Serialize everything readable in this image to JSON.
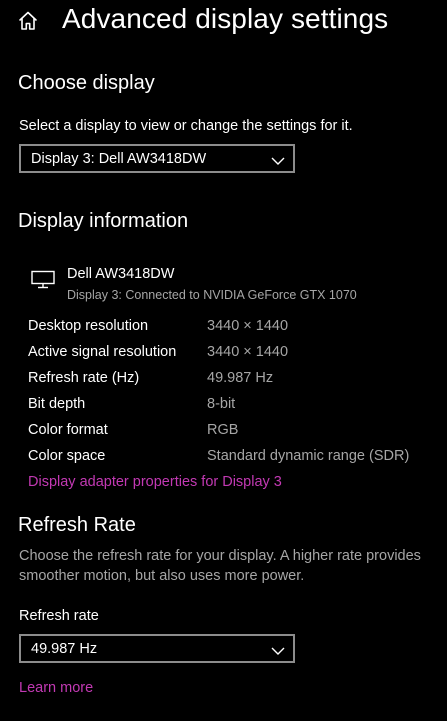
{
  "header": {
    "title": "Advanced display settings",
    "home_icon": "home-icon"
  },
  "choose_display": {
    "title": "Choose display",
    "instruction": "Select a display to view or change the settings for it.",
    "selected_display": "Display 3: Dell AW3418DW"
  },
  "display_info": {
    "title": "Display information",
    "monitor_icon": "monitor-icon",
    "monitor_name": "Dell AW3418DW",
    "connection": "Display 3: Connected to NVIDIA GeForce GTX 1070",
    "rows": [
      {
        "label": "Desktop resolution",
        "value": "3440 × 1440"
      },
      {
        "label": "Active signal resolution",
        "value": "3440 × 1440"
      },
      {
        "label": "Refresh rate (Hz)",
        "value": "49.987 Hz"
      },
      {
        "label": "Bit depth",
        "value": "8-bit"
      },
      {
        "label": "Color format",
        "value": "RGB"
      },
      {
        "label": "Color space",
        "value": "Standard dynamic range (SDR)"
      }
    ],
    "adapter_link": "Display adapter properties for Display 3"
  },
  "refresh_rate": {
    "title": "Refresh Rate",
    "description": "Choose the refresh rate for your display. A higher rate provides smoother motion, but also uses more power.",
    "field_label": "Refresh rate",
    "selected_rate": "49.987 Hz",
    "learn_more": "Learn more"
  },
  "colors": {
    "background": "#000000",
    "text": "#ffffff",
    "secondary_text": "#a6a6a6",
    "accent_link": "#c239b3",
    "dropdown_border": "#8c8c8c"
  }
}
